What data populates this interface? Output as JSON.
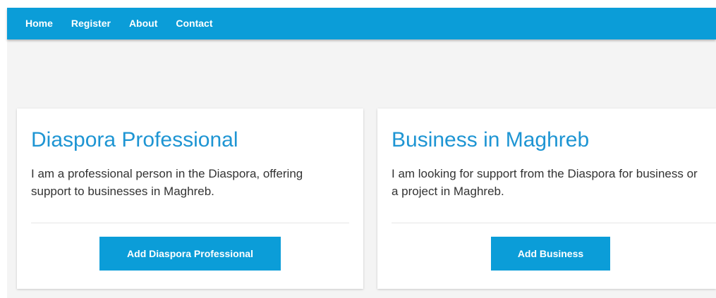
{
  "nav": {
    "items": [
      {
        "label": "Home"
      },
      {
        "label": "Register"
      },
      {
        "label": "About"
      },
      {
        "label": "Contact"
      }
    ]
  },
  "cards": [
    {
      "title": "Diaspora Professional",
      "text": "I am a professional person in the Diaspora, offering support to businesses in Maghreb.",
      "button": "Add Diaspora Professional"
    },
    {
      "title": "Business in Maghreb",
      "text": "I am looking for support from the Diaspora for business or a project in Maghreb.",
      "button": "Add Business"
    }
  ],
  "colors": {
    "primary": "#0b9dd8",
    "title": "#1e95d3",
    "background": "#f4f4f4"
  }
}
